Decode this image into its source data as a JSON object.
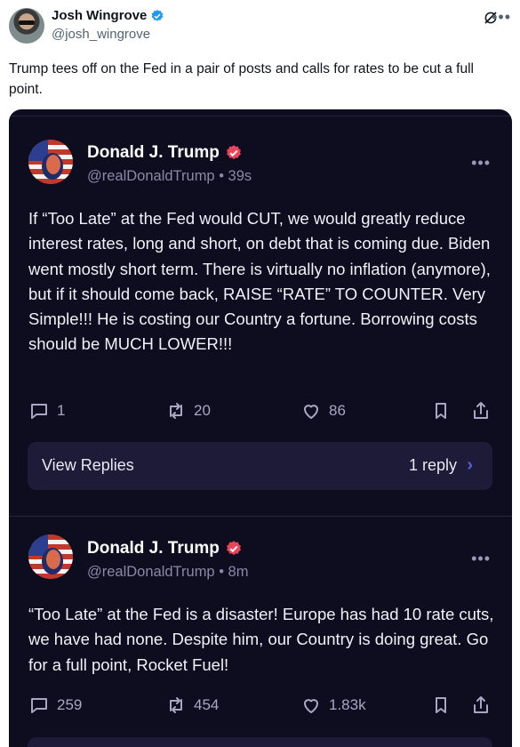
{
  "author": {
    "name": "Josh Wingrove",
    "handle": "@josh_wingrove"
  },
  "tweet_text": "Trump tees off on the Fed in a pair of posts and calls for rates to be cut a full point.",
  "colors": {
    "verified_blue": "#1d9bf0",
    "embed_bg": "#0e0d1f",
    "truth_badge": "#e8455b",
    "reply_chevron": "#5e5cd6"
  },
  "posts": [
    {
      "name": "Donald J. Trump",
      "handle_time": "@realDonaldTrump • 39s",
      "body": "If “Too Late” at the Fed would CUT, we would greatly reduce interest rates, long and short, on debt that is coming due. Biden went mostly short term. There is virtually no inflation (anymore), but if it should come back, RAISE “RATE” TO COUNTER. Very Simple!!! He is costing our Country a fortune. Borrowing costs should be MUCH LOWER!!!",
      "replies": "1",
      "retruths": "20",
      "likes": "86",
      "view_replies_label": "View Replies",
      "reply_count_label": "1 reply"
    },
    {
      "name": "Donald J. Trump",
      "handle_time": "@realDonaldTrump • 8m",
      "body": "“Too Late” at the Fed is a disaster! Europe has had 10 rate cuts, we have had none. Despite him, our Country is doing great. Go for a full point, Rocket Fuel!",
      "replies": "259",
      "retruths": "454",
      "likes": "1.83k"
    }
  ],
  "icons": [
    "grok-icon",
    "more-icon",
    "verified-badge-icon",
    "reply-icon",
    "retruth-icon",
    "like-icon",
    "bookmark-icon",
    "share-icon",
    "chevron-right-icon"
  ]
}
